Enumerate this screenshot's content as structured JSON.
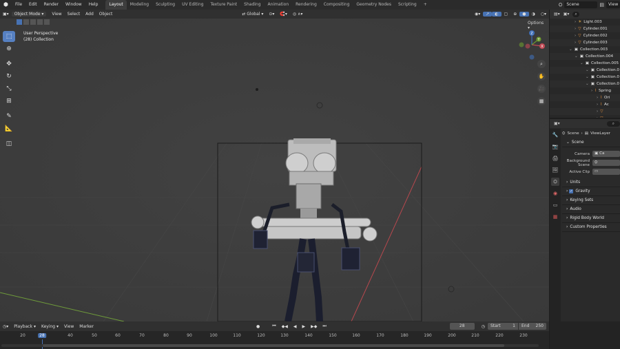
{
  "topbar": {
    "menus": [
      "File",
      "Edit",
      "Render",
      "Window",
      "Help"
    ],
    "workspaces": [
      "Layout",
      "Modeling",
      "Sculpting",
      "UV Editing",
      "Texture Paint",
      "Shading",
      "Animation",
      "Rendering",
      "Compositing",
      "Geometry Nodes",
      "Scripting"
    ],
    "active_workspace": "Layout",
    "add_tab": "+",
    "scene_name": "Scene",
    "view_layer": "View"
  },
  "viewport_header": {
    "mode": "Object Mode",
    "menus": [
      "View",
      "Select",
      "Add",
      "Object"
    ],
    "transform_orientation": "Global",
    "options": "Options"
  },
  "viewport": {
    "perspective_label": "User Perspective",
    "collection_label": "(28) Collection",
    "gizmo_axes": [
      "Z",
      "X",
      "Y"
    ]
  },
  "outliner": {
    "rows": [
      {
        "indent": 0,
        "icon": "light-icon",
        "label": "Light.003"
      },
      {
        "indent": 0,
        "icon": "mesh-icon",
        "label": "Cylinder.001"
      },
      {
        "indent": 0,
        "icon": "mesh-icon",
        "label": "Cylinder.002"
      },
      {
        "indent": 0,
        "icon": "mesh-icon",
        "label": "Cylinder.003"
      },
      {
        "indent": -1,
        "icon": "collection-icon",
        "label": "Collection.003"
      },
      {
        "indent": 0,
        "icon": "collection-icon",
        "label": "Collection.004"
      },
      {
        "indent": 1,
        "icon": "collection-icon",
        "label": "Collection.005"
      },
      {
        "indent": 2,
        "icon": "collection-icon",
        "label": "Collection.0"
      },
      {
        "indent": 2,
        "icon": "collection-icon",
        "label": "Collection.0"
      },
      {
        "indent": 2,
        "icon": "collection-icon",
        "label": "Collection.0"
      },
      {
        "indent": 3,
        "icon": "object-icon",
        "label": "Spring"
      },
      {
        "indent": 4,
        "icon": "object-icon",
        "label": "Ori"
      },
      {
        "indent": 4,
        "icon": "object-icon",
        "label": "Ac"
      },
      {
        "indent": 4,
        "icon": "mesh-icon",
        "label": ""
      },
      {
        "indent": 4,
        "icon": "mesh-icon",
        "label": ""
      }
    ]
  },
  "properties": {
    "breadcrumb_scene": "Scene",
    "breadcrumb_layer": "ViewLayer",
    "section_title": "Scene",
    "fields": [
      {
        "label": "Camera",
        "value": "Ca"
      },
      {
        "label": "Background Scene",
        "value": ""
      },
      {
        "label": "Active Clip",
        "value": ""
      }
    ],
    "sections": [
      "Units",
      "Gravity",
      "Keying Sets",
      "Audio",
      "Rigid Body World",
      "Custom Properties"
    ],
    "gravity_checked": true
  },
  "timeline": {
    "menus": [
      "Playback",
      "Keying",
      "View",
      "Marker"
    ],
    "current_frame": "28",
    "start_label": "Start",
    "start_value": "1",
    "end_label": "End",
    "end_value": "250",
    "ticks": [
      "20",
      "28",
      "40",
      "50",
      "60",
      "70",
      "80",
      "90",
      "100",
      "110",
      "120",
      "130",
      "140",
      "150",
      "160",
      "170",
      "180",
      "190",
      "200",
      "210",
      "220",
      "230"
    ],
    "playhead_frame": "28"
  },
  "colors": {
    "accent": "#5680c2",
    "viewport_bg": "#3e3e3e",
    "header_bg": "#303030",
    "playhead": "#4772b3"
  }
}
